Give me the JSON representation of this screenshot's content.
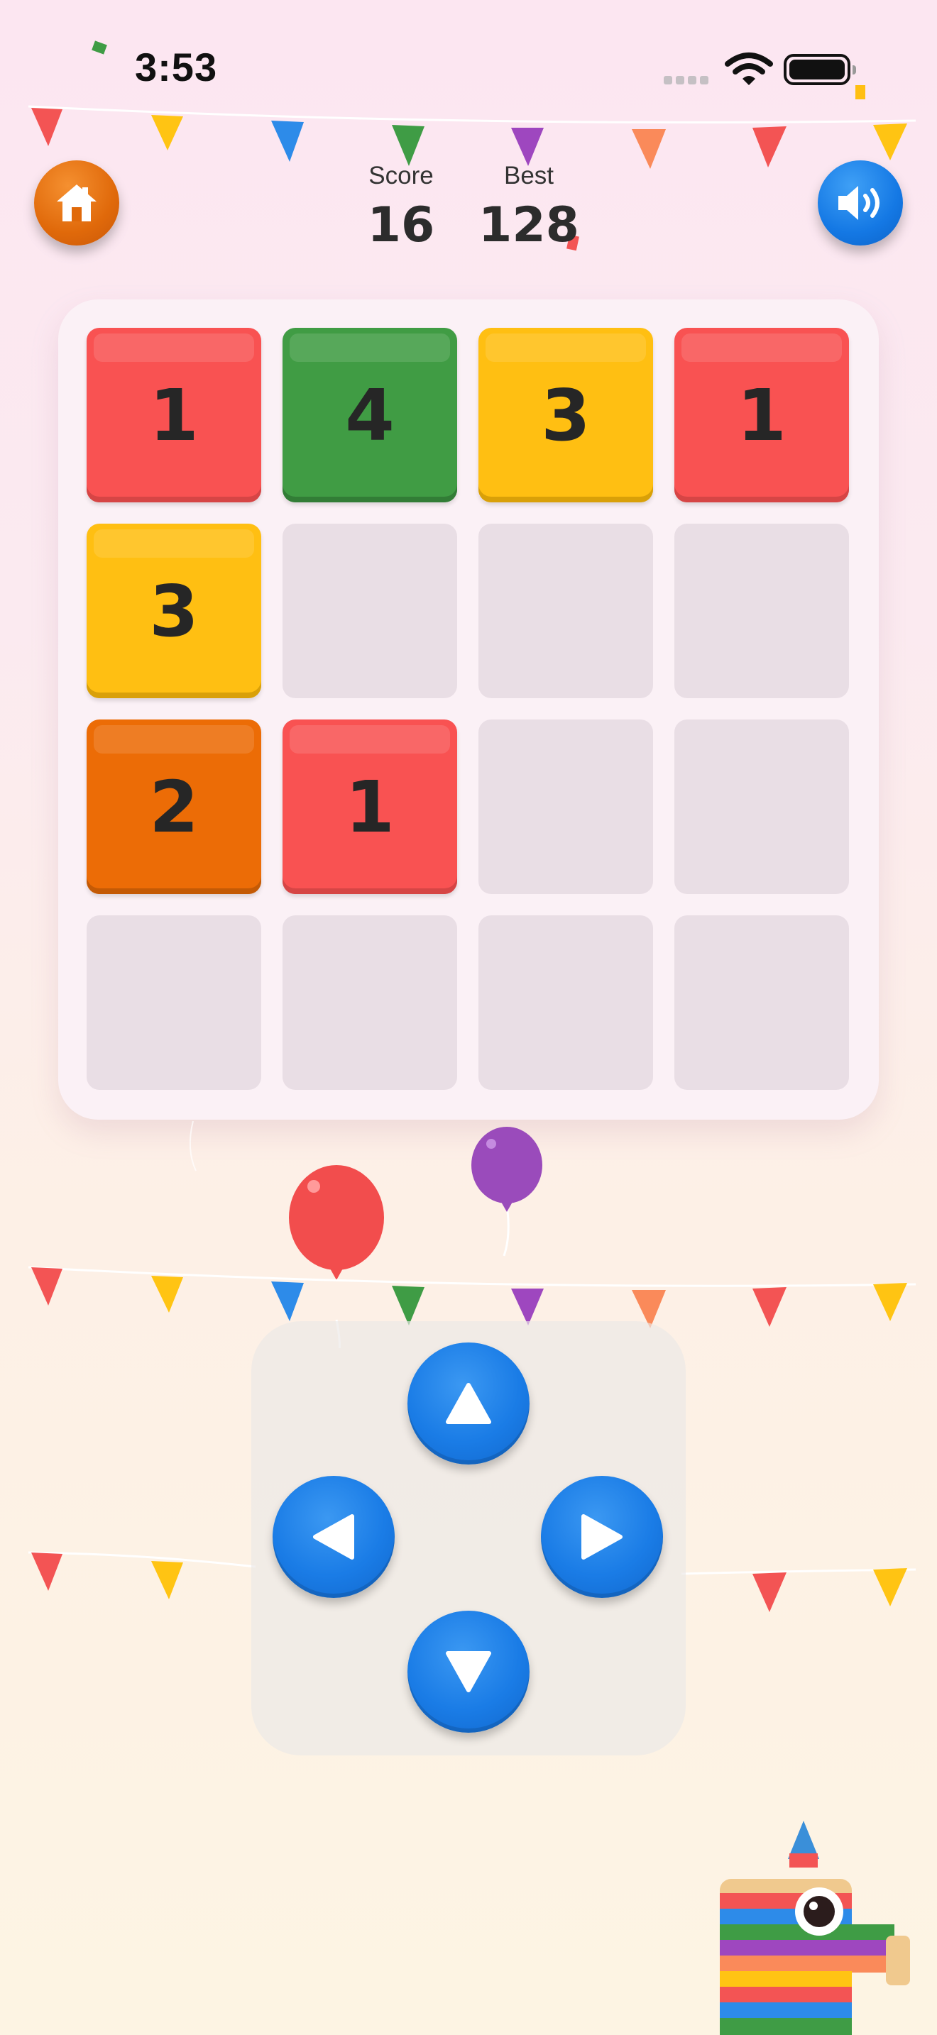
{
  "status_bar": {
    "time": "3:53"
  },
  "header": {
    "score_label": "Score",
    "score_value": "16",
    "best_label": "Best",
    "best_value": "128"
  },
  "board": {
    "rows": [
      [
        "1",
        "4",
        "3",
        "1"
      ],
      [
        "3",
        "",
        "",
        ""
      ],
      [
        "2",
        "1",
        "",
        ""
      ],
      [
        "",
        "",
        "",
        ""
      ]
    ]
  },
  "icons": {
    "home": "home-icon",
    "sound": "speaker-icon",
    "up": "arrow-up-icon",
    "down": "arrow-down-icon",
    "left": "arrow-left-icon",
    "right": "arrow-right-icon"
  },
  "colors": {
    "tile_1": "#f95252",
    "tile_2": "#ec6c06",
    "tile_3": "#ffbf12",
    "tile_4": "#409c44",
    "empty_cell": "#e9dee5",
    "button_blue": "#1a7ce6",
    "button_orange": "#e0690a"
  }
}
